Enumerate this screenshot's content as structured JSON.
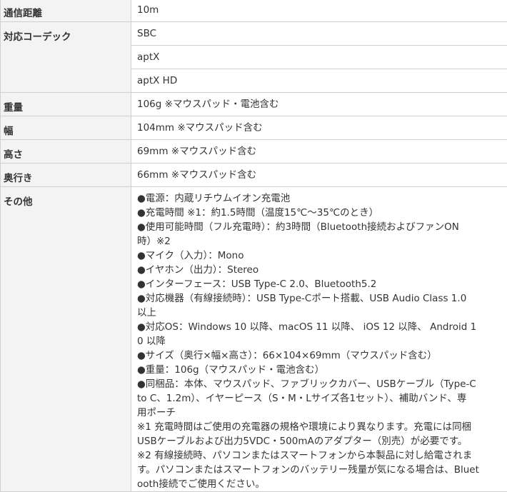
{
  "rows": [
    {
      "label": "通信距離",
      "values": [
        "10m"
      ]
    },
    {
      "label": "対応コーデック",
      "values": [
        "SBC",
        "aptX",
        "aptX HD"
      ]
    },
    {
      "label": "重量",
      "values": [
        "106g ※マウスパッド・電池含む"
      ]
    },
    {
      "label": "幅",
      "values": [
        "104mm ※マウスパッド含む"
      ]
    },
    {
      "label": "高さ",
      "values": [
        "69mm ※マウスパッド含む"
      ]
    },
    {
      "label": "奥行き",
      "values": [
        "66mm ※マウスパッド含む"
      ]
    }
  ],
  "other": {
    "label": "その他",
    "lines": [
      "●電源：内蔵リチウムイオン充電池",
      "●充電時間 ※1：約1.5時間（温度15℃～35℃のとき）",
      "●使用可能時間（フル充電時）：約3時間（Bluetooth接続およびファンON",
      "時）※2",
      "●マイク（入力）：Mono",
      "●イヤホン（出力）：Stereo",
      "●インターフェース：USB Type-C 2.0、Bluetooth5.2",
      "●対応機器（有線接続時）：USB Type-Cポート搭載、USB Audio Class 1.0",
      "以上",
      "●対応OS：Windows 10 以降、macOS 11 以降、 iOS 12 以降、 Android 1",
      "0 以降",
      "●サイズ（奥行×幅×高さ）：66×104×69mm（マウスパッド含む）",
      "●重量：106g（マウスパッド・電池含む）",
      "●同梱品：本体、マウスパッド、ファブリックカバー、USBケーブル（Type-C",
      "to C、1.2m）、イヤーピース（S・M・Lサイズ各1セット）、補助バンド、専",
      "用ポーチ",
      "※1 充電時間はご使用の充電器の規格や環境により異なります。充電には同梱",
      "USBケーブルおよび出力5VDC・500mAのアダプター（別売）が必要です。",
      "※2 有線接続時、パソコンまたはスマートフォンから本製品に対し給電されま",
      "す。パソコンまたはスマートフォンのバッテリー残量が気になる場合は、Bluet",
      "ooth接続でご使用ください。"
    ]
  }
}
